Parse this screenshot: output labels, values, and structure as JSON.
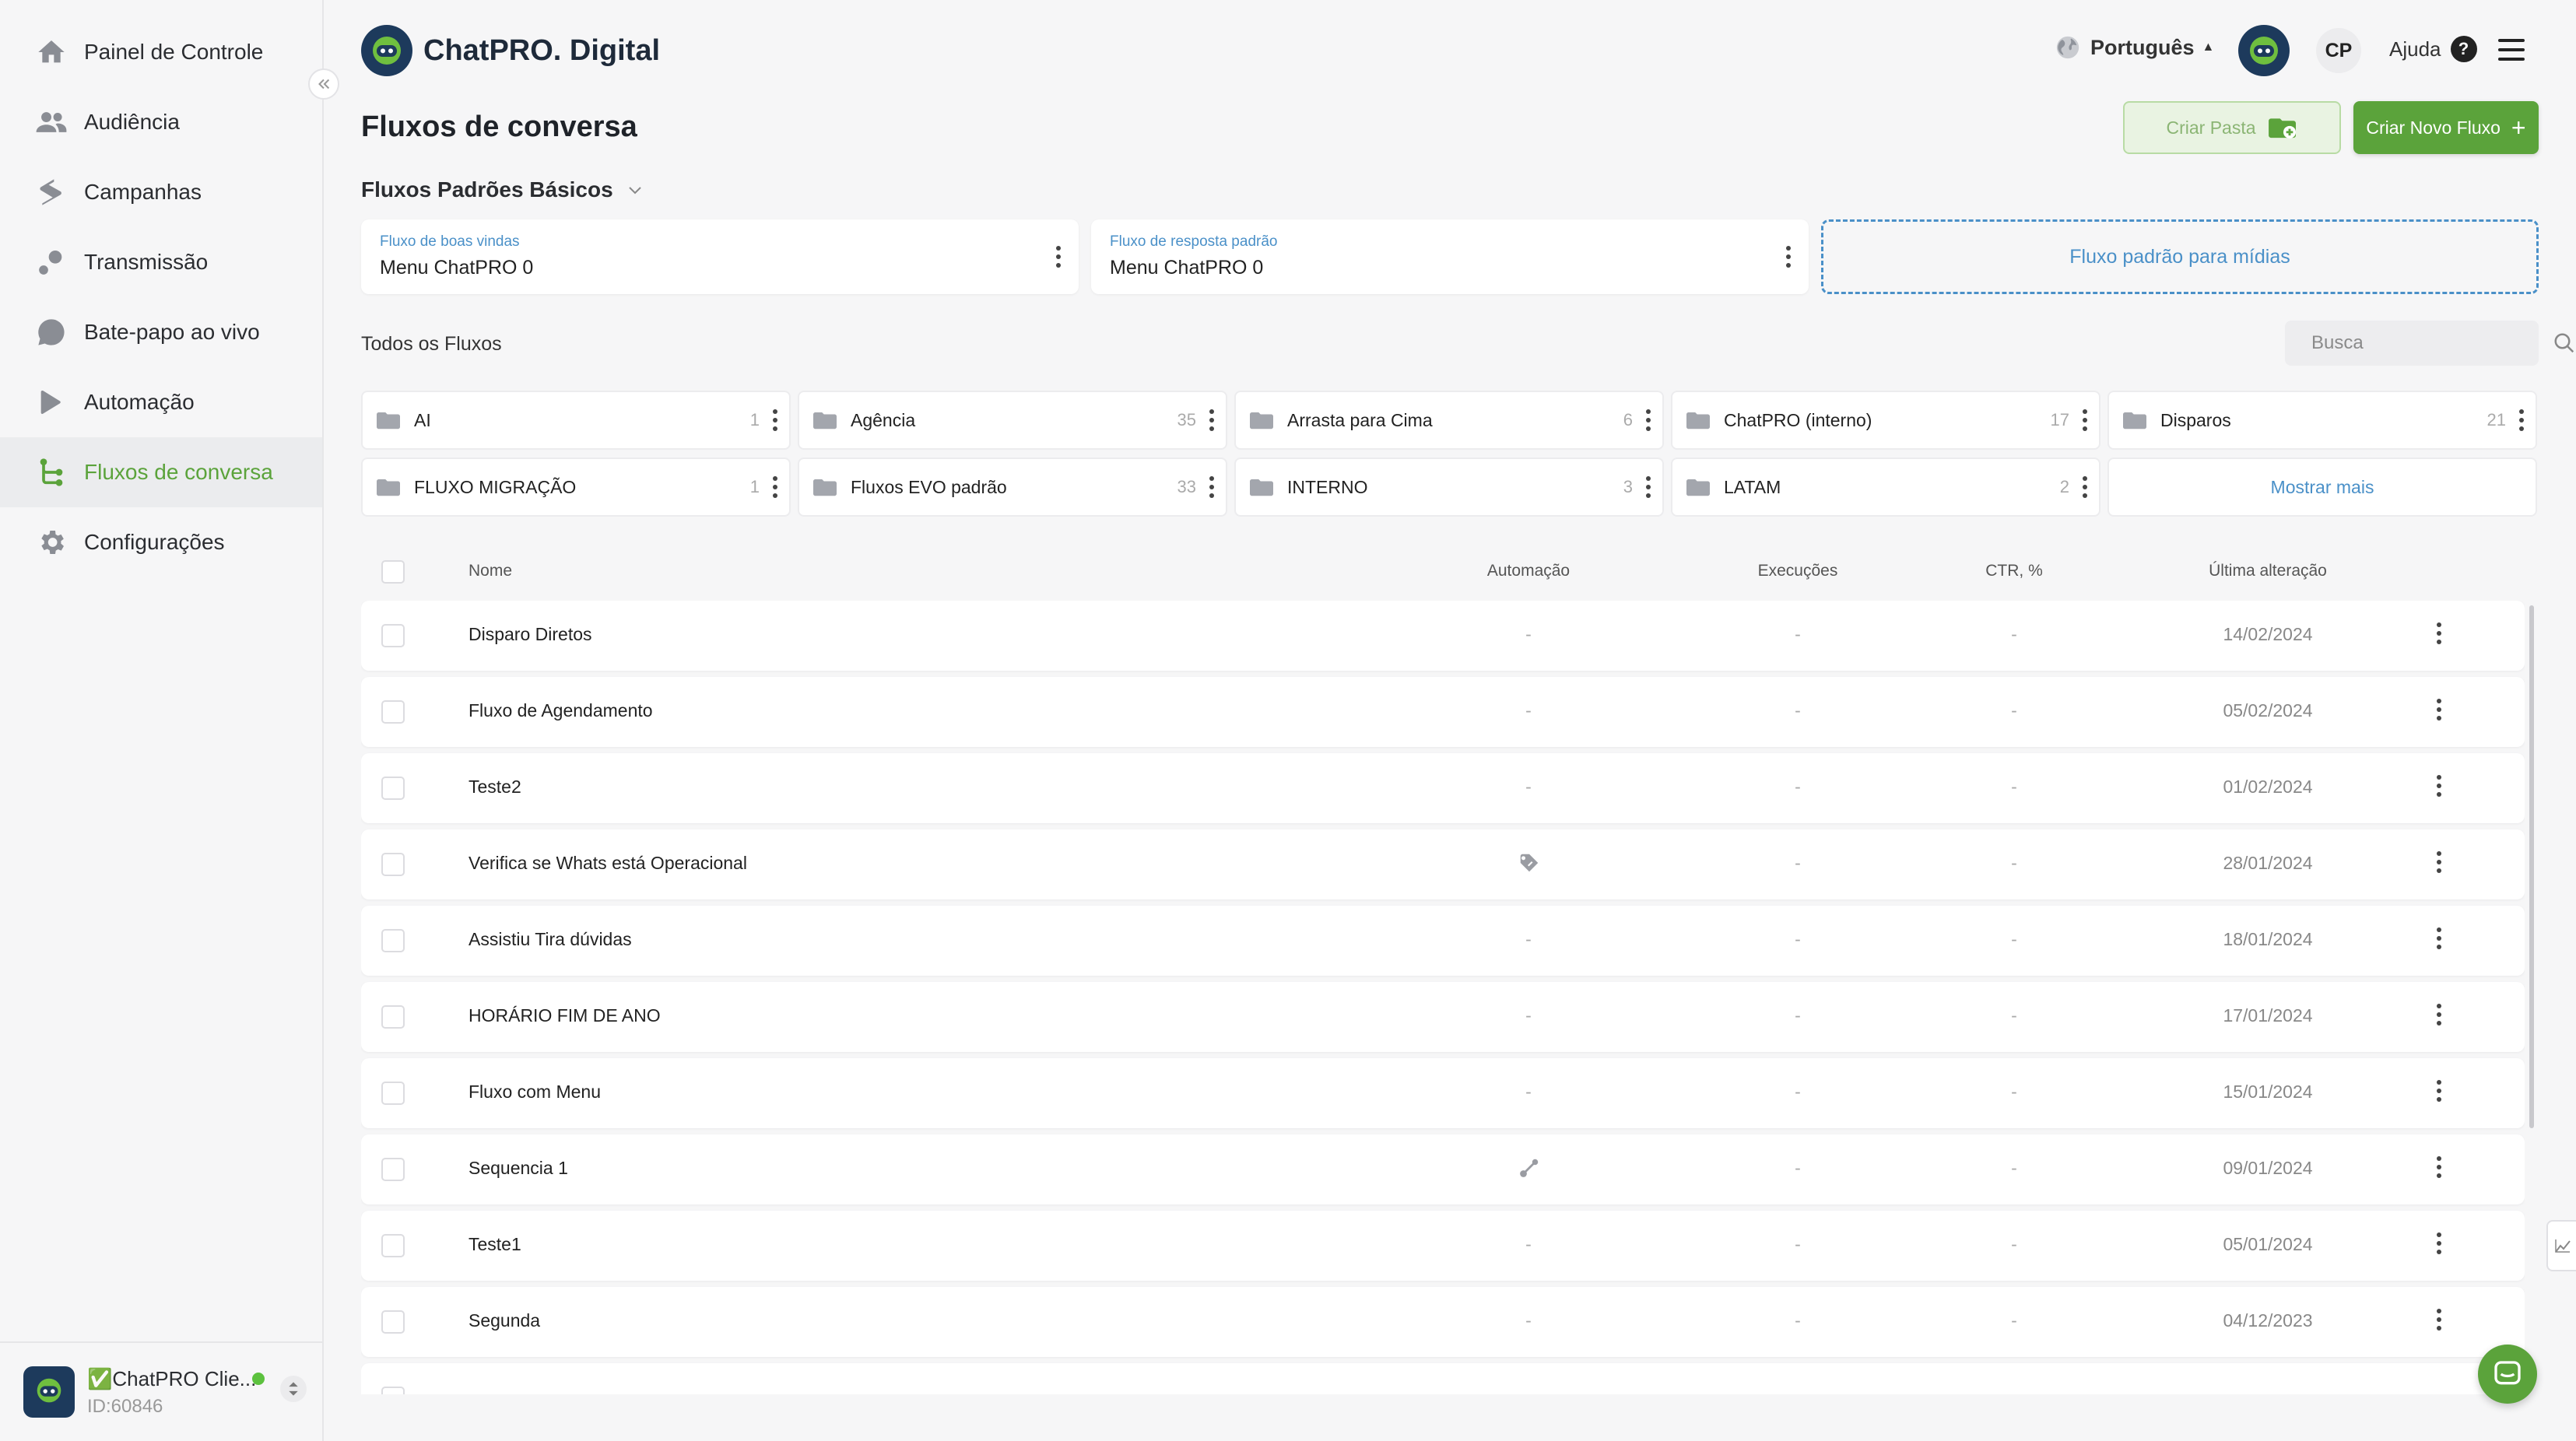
{
  "app": {
    "brand_name": "ChatPRO. Digital",
    "accent_color": "#5ba33b",
    "link_color": "#4a90c8"
  },
  "sidebar": {
    "items": [
      {
        "label": "Painel de Controle",
        "icon": "home-icon"
      },
      {
        "label": "Audiência",
        "icon": "users-icon"
      },
      {
        "label": "Campanhas",
        "icon": "campaign-icon"
      },
      {
        "label": "Transmissão",
        "icon": "broadcast-icon"
      },
      {
        "label": "Bate-papo ao vivo",
        "icon": "chat-bubble-icon"
      },
      {
        "label": "Automação",
        "icon": "automation-icon"
      },
      {
        "label": "Fluxos de conversa",
        "icon": "flow-icon",
        "active": true
      },
      {
        "label": "Configurações",
        "icon": "gear-icon"
      }
    ],
    "account": {
      "name": "✅ChatPRO Clie...",
      "id": "ID:60846"
    }
  },
  "header": {
    "language": "Português",
    "initials": "CP",
    "help_label": "Ajuda"
  },
  "page": {
    "title": "Fluxos de conversa",
    "create_folder_label": "Criar Pasta",
    "create_flow_label": "Criar Novo Fluxo"
  },
  "defaults": {
    "section_title": "Fluxos Padrões Básicos",
    "welcome_label": "Fluxo de boas vindas",
    "welcome_value": "Menu ChatPRO 0",
    "default_reply_label": "Fluxo de resposta padrão",
    "default_reply_value": "Menu ChatPRO 0",
    "media_label": "Fluxo padrão para mídias"
  },
  "all_flows": {
    "title": "Todos os Fluxos",
    "search_placeholder": "Busca",
    "show_more": "Mostrar mais",
    "folders": [
      {
        "name": "AI",
        "count": "1"
      },
      {
        "name": "Agência",
        "count": "35"
      },
      {
        "name": "Arrasta para Cima",
        "count": "6"
      },
      {
        "name": "ChatPRO (interno)",
        "count": "17"
      },
      {
        "name": "Disparos",
        "count": "21"
      },
      {
        "name": "FLUXO MIGRAÇÃO",
        "count": "1"
      },
      {
        "name": "Fluxos EVO padrão",
        "count": "33"
      },
      {
        "name": "INTERNO",
        "count": "3"
      },
      {
        "name": "LATAM",
        "count": "2"
      }
    ]
  },
  "table": {
    "columns": {
      "name": "Nome",
      "automation": "Automação",
      "executions": "Execuções",
      "ctr": "CTR, %",
      "last_modified": "Última alteração"
    },
    "rows": [
      {
        "name": "Disparo Diretos",
        "automation": "-",
        "executions": "-",
        "ctr": "-",
        "date": "14/02/2024"
      },
      {
        "name": "Fluxo de Agendamento",
        "automation": "-",
        "executions": "-",
        "ctr": "-",
        "date": "05/02/2024"
      },
      {
        "name": "Teste2",
        "automation": "-",
        "executions": "-",
        "ctr": "-",
        "date": "01/02/2024"
      },
      {
        "name": "Verifica se Whats está Operacional",
        "automation_icon": "tag-icon",
        "executions": "-",
        "ctr": "-",
        "date": "28/01/2024"
      },
      {
        "name": "Assistiu Tira dúvidas",
        "automation": "-",
        "executions": "-",
        "ctr": "-",
        "date": "18/01/2024"
      },
      {
        "name": "HORÁRIO FIM DE ANO",
        "automation": "-",
        "executions": "-",
        "ctr": "-",
        "date": "17/01/2024"
      },
      {
        "name": "Fluxo com Menu",
        "automation": "-",
        "executions": "-",
        "ctr": "-",
        "date": "15/01/2024"
      },
      {
        "name": "Sequencia 1",
        "automation_icon": "link-icon",
        "executions": "-",
        "ctr": "-",
        "date": "09/01/2024"
      },
      {
        "name": "Teste1",
        "automation": "-",
        "executions": "-",
        "ctr": "-",
        "date": "05/01/2024"
      },
      {
        "name": "Segunda",
        "automation": "-",
        "executions": "-",
        "ctr": "-",
        "date": "04/12/2023"
      }
    ]
  }
}
